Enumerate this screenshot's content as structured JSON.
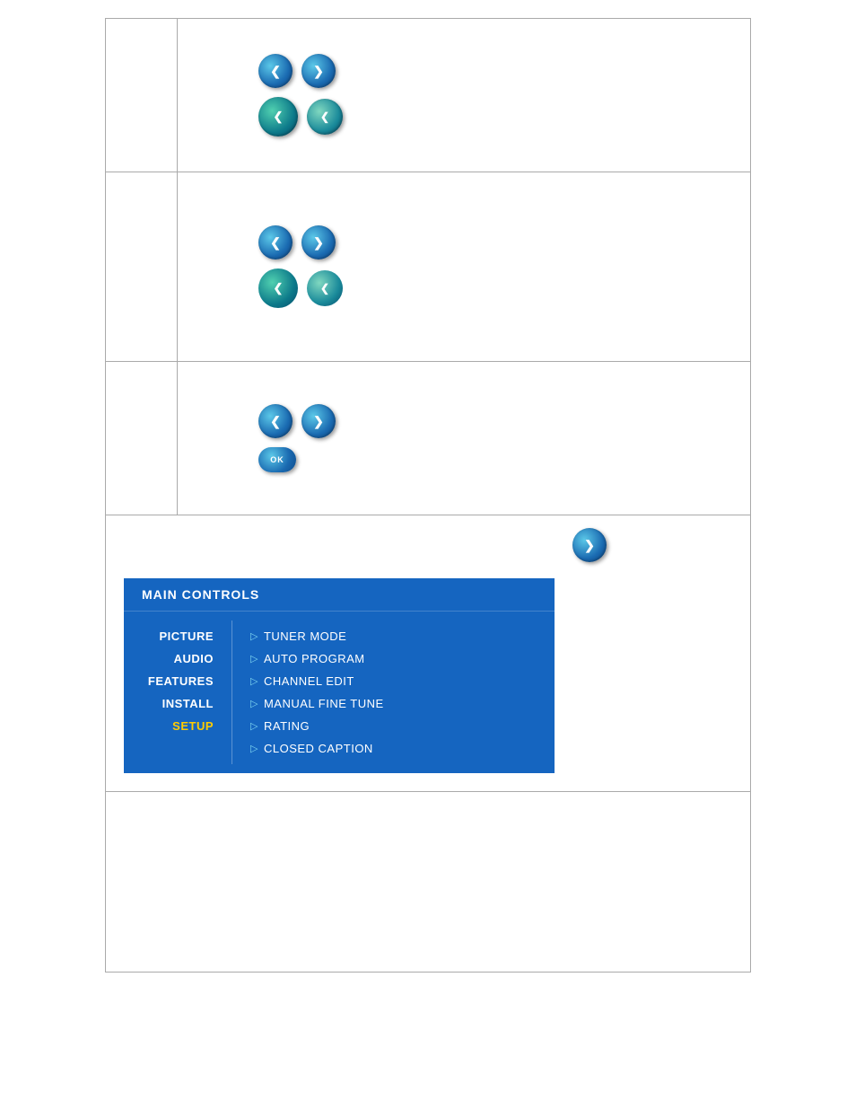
{
  "rows": {
    "row1": {
      "has_left_right_arrows": true,
      "has_down_up_arrows": true
    },
    "row2": {
      "has_left_right_arrows": true,
      "has_down_up_arrows": true
    },
    "row3": {
      "has_left_right_arrows": true,
      "has_ok_button": true,
      "ok_label": "OK"
    },
    "row4": {
      "has_right_arrow": true
    }
  },
  "menu": {
    "title": "MAIN  CONTROLS",
    "left_items": [
      {
        "label": "PICTURE",
        "active": false
      },
      {
        "label": "AUDIO",
        "active": false
      },
      {
        "label": "FEATURES",
        "active": false
      },
      {
        "label": "INSTALL",
        "active": false
      },
      {
        "label": "SETUP",
        "active": true
      }
    ],
    "right_items": [
      {
        "label": "TUNER MODE"
      },
      {
        "label": "AUTO PROGRAM"
      },
      {
        "label": "CHANNEL EDIT"
      },
      {
        "label": "MANUAL FINE TUNE"
      },
      {
        "label": "RATING"
      },
      {
        "label": "CLOSED CAPTION"
      }
    ]
  },
  "buttons": {
    "left_arrow": "❮",
    "right_arrow": "❯",
    "ok": "OK"
  }
}
